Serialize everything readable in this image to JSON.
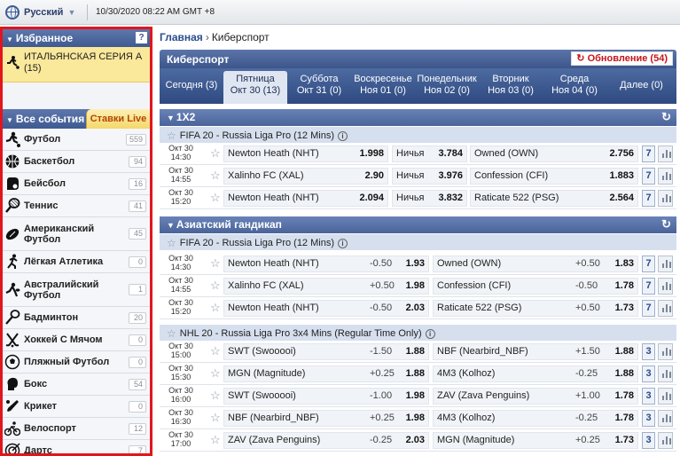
{
  "topbar": {
    "language": "Русский",
    "datetime": "10/30/2020 08:22 AM GMT +8"
  },
  "sidebar": {
    "favorites_title": "Избранное",
    "help_label": "?",
    "favorite_item": "ИТАЛЬЯНСКАЯ СЕРИЯ А (15)",
    "all_events_title": "Все события",
    "live_tab": "Ставки Live",
    "sports": [
      {
        "name": "Футбол",
        "count": "559",
        "icon": "soccer-player-icon"
      },
      {
        "name": "Баскетбол",
        "count": "94",
        "icon": "basketball-icon"
      },
      {
        "name": "Бейсбол",
        "count": "16",
        "icon": "baseball-glove-icon"
      },
      {
        "name": "Теннис",
        "count": "41",
        "icon": "tennis-racket-icon"
      },
      {
        "name": "Американский Футбол",
        "count": "45",
        "icon": "american-football-icon"
      },
      {
        "name": "Лёгкая Атлетика",
        "count": "0",
        "icon": "runner-icon"
      },
      {
        "name": "Австралийский Футбол",
        "count": "1",
        "icon": "australian-football-icon"
      },
      {
        "name": "Бадминтон",
        "count": "20",
        "icon": "badminton-racket-icon"
      },
      {
        "name": "Хоккей С Мячом",
        "count": "0",
        "icon": "bandy-sticks-icon"
      },
      {
        "name": "Пляжный Футбол",
        "count": "0",
        "icon": "beach-soccer-icon"
      },
      {
        "name": "Бокс",
        "count": "54",
        "icon": "boxing-glove-icon"
      },
      {
        "name": "Крикет",
        "count": "0",
        "icon": "cricket-bat-icon"
      },
      {
        "name": "Велоспорт",
        "count": "12",
        "icon": "cyclist-icon"
      },
      {
        "name": "Дартс",
        "count": "7",
        "icon": "darts-icon"
      }
    ]
  },
  "main": {
    "breadcrumb_home": "Главная",
    "breadcrumb_current": "Киберспорт",
    "panel_title": "Киберспорт",
    "refresh_label": "Обновление (54)",
    "days": [
      {
        "l1": "Сегодня (3)",
        "l2": ""
      },
      {
        "l1": "Пятница",
        "l2": "Окт 30 (13)"
      },
      {
        "l1": "Суббота",
        "l2": "Окт 31 (0)"
      },
      {
        "l1": "Воскресенье",
        "l2": "Ноя 01 (0)"
      },
      {
        "l1": "Понедельник",
        "l2": "Ноя 02 (0)"
      },
      {
        "l1": "Вторник",
        "l2": "Ноя 03 (0)"
      },
      {
        "l1": "Среда",
        "l2": "Ноя 04 (0)"
      },
      {
        "l1": "Далее (0)",
        "l2": ""
      }
    ],
    "section_1x2": "1X2",
    "league_fifa": "FIFA 20 - Russia Liga Pro (12 Mins)",
    "draw_label": "Ничья",
    "rows_1x2": [
      {
        "date": "Окт 30",
        "time": "14:30",
        "home": "Newton Heath (NHT)",
        "o1": "1.998",
        "ox": "3.784",
        "away": "Owned (OWN)",
        "o2": "2.756",
        "more": "7"
      },
      {
        "date": "Окт 30",
        "time": "14:55",
        "home": "Xalinho FC (XAL)",
        "o1": "2.90",
        "ox": "3.976",
        "away": "Confession (CFI)",
        "o2": "1.883",
        "more": "7"
      },
      {
        "date": "Окт 30",
        "time": "15:20",
        "home": "Newton Heath (NHT)",
        "o1": "2.094",
        "ox": "3.832",
        "away": "Raticate 522 (PSG)",
        "o2": "2.564",
        "more": "7"
      }
    ],
    "section_asian": "Азиатский гандикап",
    "rows_asian_fifa": [
      {
        "date": "Окт 30",
        "time": "14:30",
        "home": "Newton Heath (NHT)",
        "h1": "-0.50",
        "o1": "1.93",
        "away": "Owned (OWN)",
        "h2": "+0.50",
        "o2": "1.83",
        "more": "7"
      },
      {
        "date": "Окт 30",
        "time": "14:55",
        "home": "Xalinho FC (XAL)",
        "h1": "+0.50",
        "o1": "1.98",
        "away": "Confession (CFI)",
        "h2": "-0.50",
        "o2": "1.78",
        "more": "7"
      },
      {
        "date": "Окт 30",
        "time": "15:20",
        "home": "Newton Heath (NHT)",
        "h1": "-0.50",
        "o1": "2.03",
        "away": "Raticate 522 (PSG)",
        "h2": "+0.50",
        "o2": "1.73",
        "more": "7"
      }
    ],
    "league_nhl": "NHL 20 - Russia Liga Pro 3x4 Mins (Regular Time Only)",
    "rows_asian_nhl": [
      {
        "date": "Окт 30",
        "time": "15:00",
        "home": "SWT (Swooooi)",
        "h1": "-1.50",
        "o1": "1.88",
        "away": "NBF (Nearbird_NBF)",
        "h2": "+1.50",
        "o2": "1.88",
        "more": "3"
      },
      {
        "date": "Окт 30",
        "time": "15:30",
        "home": "MGN (Magnitude)",
        "h1": "+0.25",
        "o1": "1.88",
        "away": "4M3 (Kolhoz)",
        "h2": "-0.25",
        "o2": "1.88",
        "more": "3"
      },
      {
        "date": "Окт 30",
        "time": "16:00",
        "home": "SWT (Swooooi)",
        "h1": "-1.00",
        "o1": "1.98",
        "away": "ZAV (Zava Penguins)",
        "h2": "+1.00",
        "o2": "1.78",
        "more": "3"
      },
      {
        "date": "Окт 30",
        "time": "16:30",
        "home": "NBF (Nearbird_NBF)",
        "h1": "+0.25",
        "o1": "1.98",
        "away": "4M3 (Kolhoz)",
        "h2": "-0.25",
        "o2": "1.78",
        "more": "3"
      },
      {
        "date": "Окт 30",
        "time": "17:00",
        "home": "ZAV (Zava Penguins)",
        "h1": "-0.25",
        "o1": "2.03",
        "away": "MGN (Magnitude)",
        "h2": "+0.25",
        "o2": "1.73",
        "more": "3"
      }
    ]
  }
}
